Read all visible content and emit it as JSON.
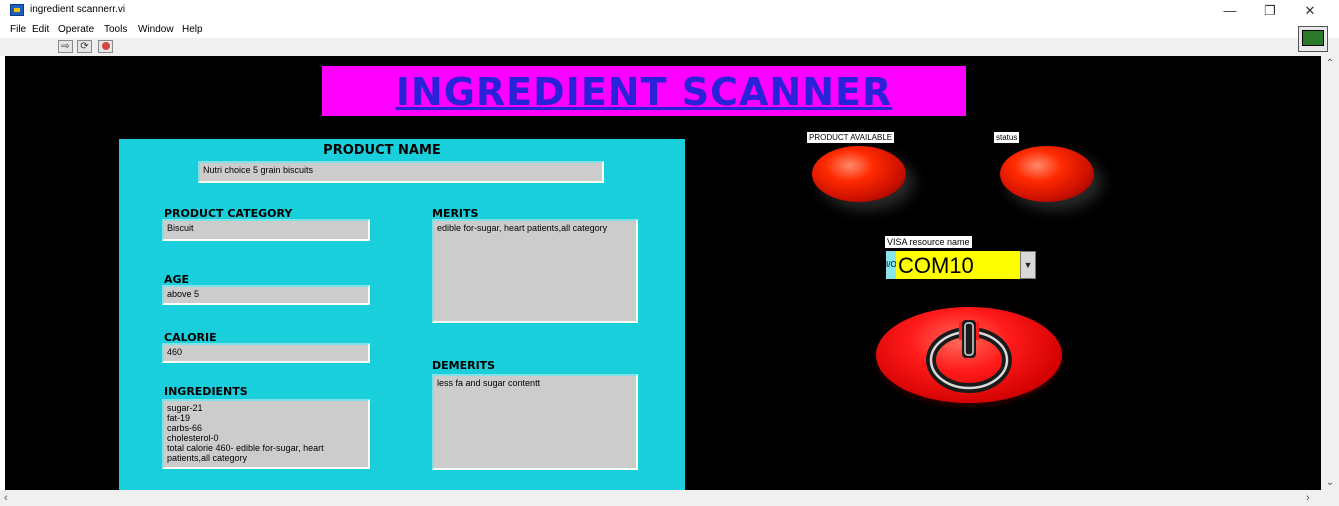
{
  "window": {
    "title": "ingredient scannerr.vi",
    "controls": {
      "minimize": "—",
      "restore": "❐",
      "close": "✕"
    }
  },
  "menu": [
    "File",
    "Edit",
    "Operate",
    "Tools",
    "Window",
    "Help"
  ],
  "toolbar": {
    "run_icon": "run-arrow-icon",
    "continuous_icon": "run-continuously-icon",
    "abort_icon": "abort-icon"
  },
  "banner": {
    "title": "INGREDIENT SCANNER"
  },
  "product": {
    "name_label": "PRODUCT  NAME",
    "name_value": "Nutri choice  5 grain biscuits",
    "category_label": "PRODUCT CATEGORY",
    "category_value": "Biscuit",
    "age_label": "AGE",
    "age_value": "above 5",
    "calorie_label": "CALORIE",
    "calorie_value": "460",
    "ingredients_label": "INGREDIENTS",
    "ingredients_value": "sugar-21\nfat-19\ncarbs-66\ncholesterol-0\ntotal calorie 460- edible for-sugar, heart patients,all category",
    "merits_label": "MERITS",
    "merits_value": "edible for-sugar, heart patients,all category",
    "demerits_label": "DEMERITS",
    "demerits_value": "less fa and sugar contentt"
  },
  "indicators": {
    "available_label": "PRODUCT AVAILABLE",
    "status_label": "status"
  },
  "visa": {
    "label": "VISA resource name",
    "io_glyph": "I/O",
    "value": "COM10"
  },
  "colors": {
    "panel_bg": "#000000",
    "banner_bg": "#ff00ff",
    "banner_text": "#2a22d8",
    "cyan_box": "#19cfdc",
    "led_red": "#ff2a00",
    "visa_field": "#ffff00"
  }
}
